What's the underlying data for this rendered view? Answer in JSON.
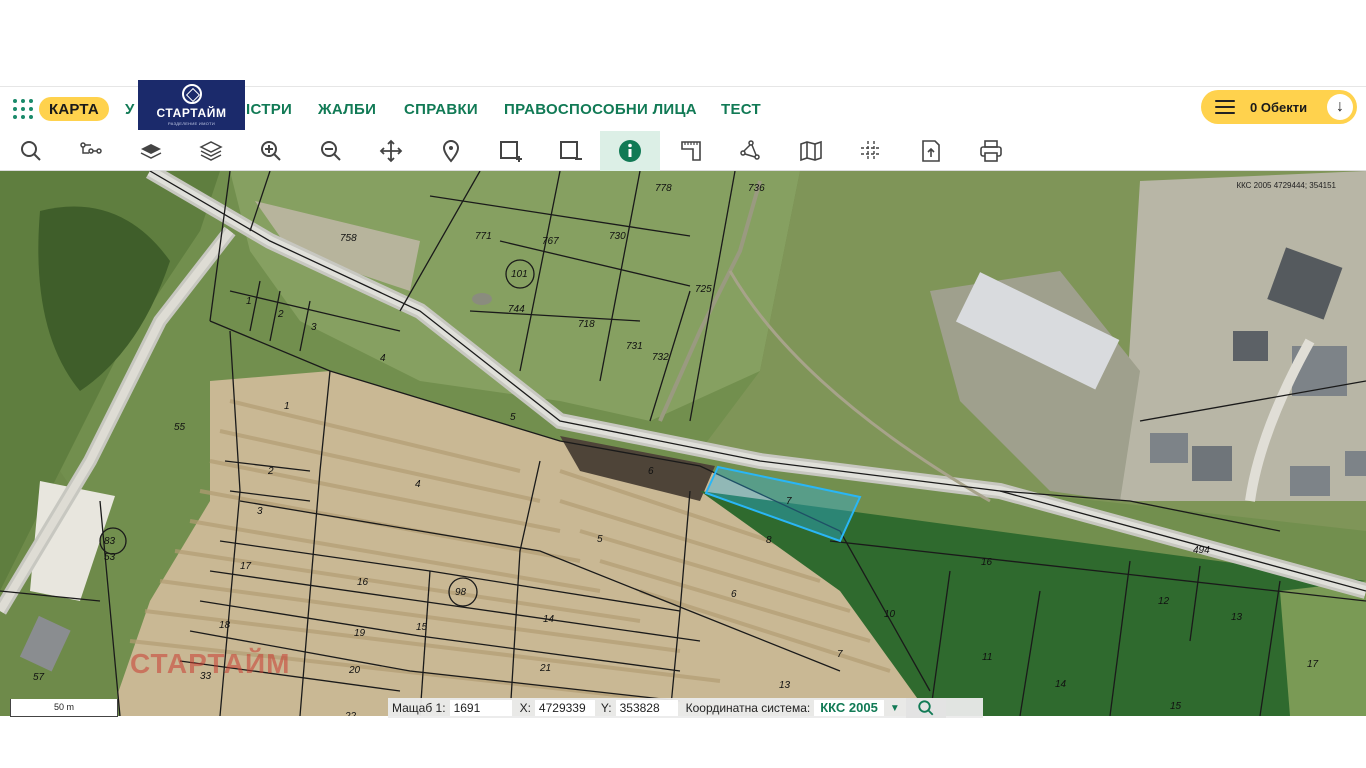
{
  "nav": {
    "karta": "КАРТА",
    "item_u": "У",
    "item_registri": "ІСТРИ",
    "item_zhalbi": "ЖАЛБИ",
    "item_spravki": "СПРАВКИ",
    "item_pravosposobni": "ПРАВОСПОСОБНИ ЛИЦА",
    "item_test": "ТЕСТ",
    "objects_label": "0 Обекти",
    "accent": "#117a55",
    "highlight": "#ffd24d"
  },
  "logo": {
    "text": "СТАРТАЙМ",
    "sub": "РАЗДЕЛЕНИЕ ИМОТИ",
    "bg": "#1b2a6b"
  },
  "toolbar": {
    "tools": [
      "search-icon",
      "route-icon",
      "layer-icon",
      "layers-icon",
      "zoom-in-icon",
      "zoom-out-icon",
      "pan-icon",
      "location-pin-icon",
      "select-add-icon",
      "select-remove-icon",
      "info-icon",
      "measure-icon",
      "polygon-icon",
      "map-icon",
      "intersection-icon",
      "export-icon",
      "print-icon"
    ],
    "active": "info-icon"
  },
  "map": {
    "coord_top": "ККС 2005 4729444; 354151",
    "watermark": "СТАРТАЙМ",
    "parcel_labels": [
      "778",
      "736",
      "771",
      "767",
      "730",
      "758",
      "101",
      "744",
      "718",
      "725",
      "731",
      "732",
      "1",
      "2",
      "3",
      "4",
      "5",
      "55",
      "1",
      "2",
      "3",
      "4",
      "6",
      "7",
      "8",
      "5",
      "83",
      "53",
      "17",
      "16",
      "98",
      "18",
      "19",
      "14",
      "6",
      "33",
      "20",
      "21",
      "7",
      "13",
      "57",
      "16",
      "10",
      "11",
      "14",
      "12",
      "13",
      "15",
      "17",
      "494",
      "15",
      "22"
    ],
    "selected_parcel": "7",
    "selected_color": "#29b6f6"
  },
  "status": {
    "scale_label": "Мащаб 1:",
    "scale_value": "1691",
    "x_label": "X:",
    "x_value": "4729339",
    "y_label": "Y:",
    "y_value": "353828",
    "crs_label": "Координатна система:",
    "crs_value": "ККС 2005",
    "scalebar": "50 m"
  }
}
